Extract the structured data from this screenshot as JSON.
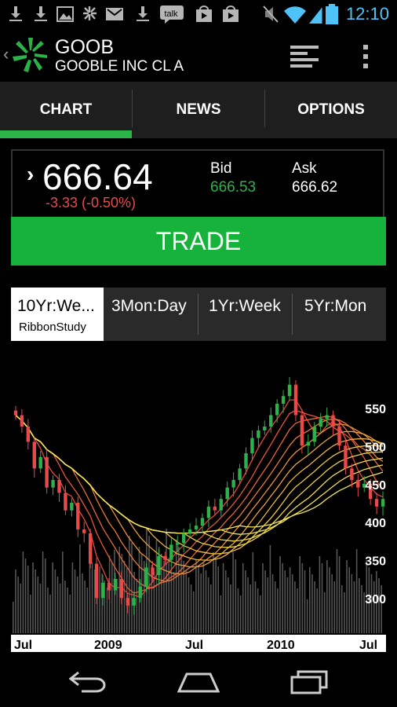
{
  "status_bar": {
    "clock": "12:10",
    "left_icons": [
      "download-icon",
      "download-icon",
      "image-icon",
      "pinwheel-icon",
      "gmail-icon",
      "download-icon",
      "talk-icon",
      "play-store-icon",
      "play-store-icon"
    ],
    "talk_label": "talk",
    "right_icons": [
      "mute-icon",
      "wifi-icon",
      "signal-icon",
      "battery-icon"
    ]
  },
  "app_bar": {
    "ticker": "GOOB",
    "company": "GOOBLE INC CL A"
  },
  "tabs": [
    {
      "label": "CHART",
      "selected": true
    },
    {
      "label": "NEWS",
      "selected": false
    },
    {
      "label": "OPTIONS",
      "selected": false
    }
  ],
  "quote": {
    "price": "666.64",
    "change": "-3.33 (-0.50%)",
    "bid_label": "Bid",
    "bid": "666.53",
    "ask_label": "Ask",
    "ask": "666.62"
  },
  "trade_label": "TRADE",
  "periods": [
    {
      "label": "10Yr:We...",
      "sub": "RibbonStudy",
      "active": true
    },
    {
      "label": "3Mon:Day",
      "active": false
    },
    {
      "label": "1Yr:Week",
      "active": false
    },
    {
      "label": "5Yr:Mon",
      "active": false
    }
  ],
  "colors": {
    "accent_green": "#17b23b",
    "negative_red": "#e84a4a",
    "clock_blue": "#4fc3f7"
  },
  "chart_data": {
    "type": "candlestick",
    "title": "",
    "xlabel": "",
    "ylabel": "",
    "x_tick_labels": [
      "Jul",
      "2009",
      "Jul",
      "2010",
      "Jul"
    ],
    "y_tick_labels": [
      "550",
      "500",
      "450",
      "400",
      "350",
      "300"
    ],
    "ylim": [
      260,
      590
    ],
    "price_points": [
      [
        0,
        540
      ],
      [
        1,
        525
      ],
      [
        2,
        505
      ],
      [
        3,
        470
      ],
      [
        4,
        485
      ],
      [
        5,
        445
      ],
      [
        6,
        455
      ],
      [
        7,
        438
      ],
      [
        8,
        415
      ],
      [
        9,
        425
      ],
      [
        10,
        390
      ],
      [
        11,
        385
      ],
      [
        12,
        345
      ],
      [
        13,
        300
      ],
      [
        14,
        320
      ],
      [
        15,
        310
      ],
      [
        16,
        325
      ],
      [
        17,
        300
      ],
      [
        18,
        290
      ],
      [
        19,
        300
      ],
      [
        20,
        315
      ],
      [
        21,
        340
      ],
      [
        22,
        330
      ],
      [
        23,
        355
      ],
      [
        24,
        350
      ],
      [
        25,
        370
      ],
      [
        26,
        372
      ],
      [
        27,
        385
      ],
      [
        28,
        390
      ],
      [
        29,
        395
      ],
      [
        30,
        405
      ],
      [
        31,
        420
      ],
      [
        32,
        415
      ],
      [
        33,
        430
      ],
      [
        34,
        445
      ],
      [
        35,
        455
      ],
      [
        36,
        470
      ],
      [
        37,
        490
      ],
      [
        38,
        510
      ],
      [
        39,
        520
      ],
      [
        40,
        525
      ],
      [
        41,
        540
      ],
      [
        42,
        555
      ],
      [
        43,
        565
      ],
      [
        44,
        580
      ],
      [
        45,
        540
      ],
      [
        46,
        500
      ],
      [
        47,
        505
      ],
      [
        48,
        525
      ],
      [
        49,
        535
      ],
      [
        50,
        540
      ],
      [
        51,
        525
      ],
      [
        52,
        500
      ],
      [
        53,
        470
      ],
      [
        54,
        455
      ],
      [
        55,
        445
      ],
      [
        56,
        450
      ],
      [
        57,
        430
      ],
      [
        58,
        420
      ],
      [
        59,
        430
      ]
    ],
    "ribbon_lines": 12,
    "volume_bars": true
  }
}
